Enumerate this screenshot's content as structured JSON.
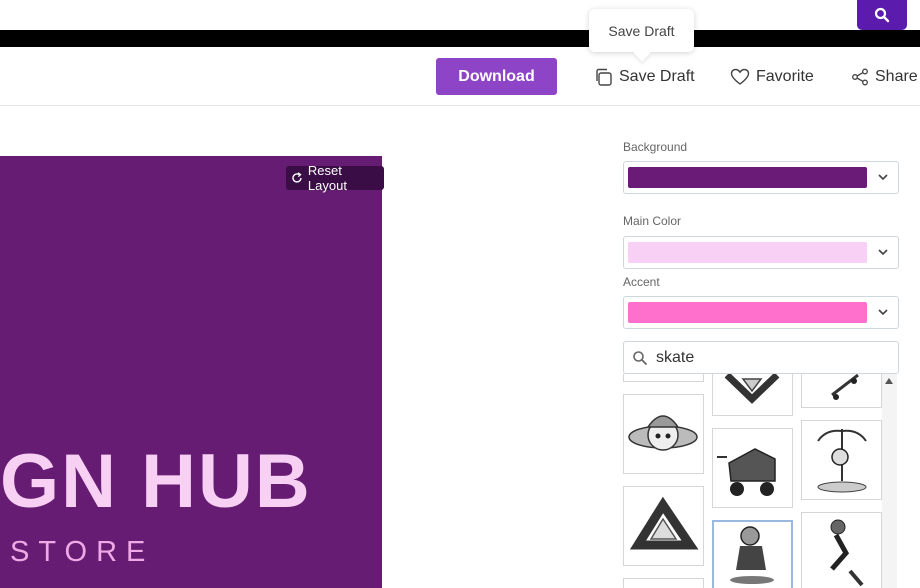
{
  "tooltip": {
    "text": "Save Draft"
  },
  "toolbar": {
    "download_label": "Download",
    "save_label": "Save Draft",
    "favorite_label": "Favorite",
    "share_label": "Share"
  },
  "canvas": {
    "reset_label": "Reset Layout",
    "title_text": "GN HUB",
    "subtitle_text": "STORE",
    "background_color": "#651c72"
  },
  "panel": {
    "background_label": "Background",
    "background_color": "#6a1b78",
    "main_color_label": "Main Color",
    "main_color": "#f8d0f6",
    "accent_label": "Accent",
    "accent_color": "#ff6fcb",
    "search_value": "skate"
  },
  "colors": {
    "brand": "#5b1cae",
    "download": "#8e44c7"
  },
  "icons": [
    "search-icon",
    "copy-icon",
    "heart-icon",
    "share-icon",
    "refresh-icon",
    "chevron-down-icon"
  ]
}
